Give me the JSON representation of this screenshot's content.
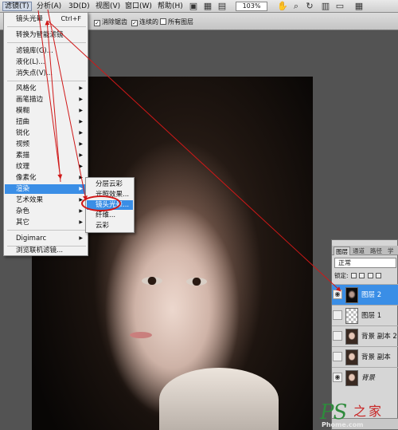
{
  "menubar": {
    "items": [
      "滤镜(T)",
      "分析(A)",
      "3D(D)",
      "视图(V)",
      "窗口(W)",
      "帮助(H)"
    ],
    "zoom": "103%"
  },
  "options": {
    "anti_alias": "消除锯齿",
    "contiguous": "连续的",
    "all_layers": "所有图层"
  },
  "filter_menu": {
    "items": [
      {
        "label": "镜头光晕",
        "shortcut": "Ctrl+F"
      },
      {
        "label": "转换为智能滤镜"
      },
      {
        "label": "滤镜库(G)..."
      },
      {
        "label": "液化(L)..."
      },
      {
        "label": "消失点(V)..."
      },
      {
        "label": "风格化"
      },
      {
        "label": "画笔描边"
      },
      {
        "label": "模糊"
      },
      {
        "label": "扭曲"
      },
      {
        "label": "锐化"
      },
      {
        "label": "视频"
      },
      {
        "label": "素描"
      },
      {
        "label": "纹理"
      },
      {
        "label": "像素化"
      },
      {
        "label": "渲染"
      },
      {
        "label": "艺术效果"
      },
      {
        "label": "杂色"
      },
      {
        "label": "其它"
      },
      {
        "label": "Digimarc"
      },
      {
        "label": "浏览联机滤镜..."
      }
    ]
  },
  "render_submenu": {
    "items": [
      "分层云彩",
      "光照效果...",
      "镜头光晕...",
      "纤维...",
      "云彩"
    ]
  },
  "layers_panel": {
    "tabs": [
      "图层",
      "通道",
      "路径",
      "学"
    ],
    "blend_mode": "正常",
    "lock_label": "锁定:",
    "layers": [
      {
        "name": "图层 2"
      },
      {
        "name": "图层 1"
      },
      {
        "name": "背景 副本 2"
      },
      {
        "name": "背景 副本"
      },
      {
        "name": "背景"
      }
    ]
  },
  "watermark": {
    "ps": "PS",
    "zhijia": "之家",
    "home": "Phome.com"
  },
  "colors": {
    "menu_highlight": "#3a8ee6",
    "arrow": "#d01818"
  }
}
